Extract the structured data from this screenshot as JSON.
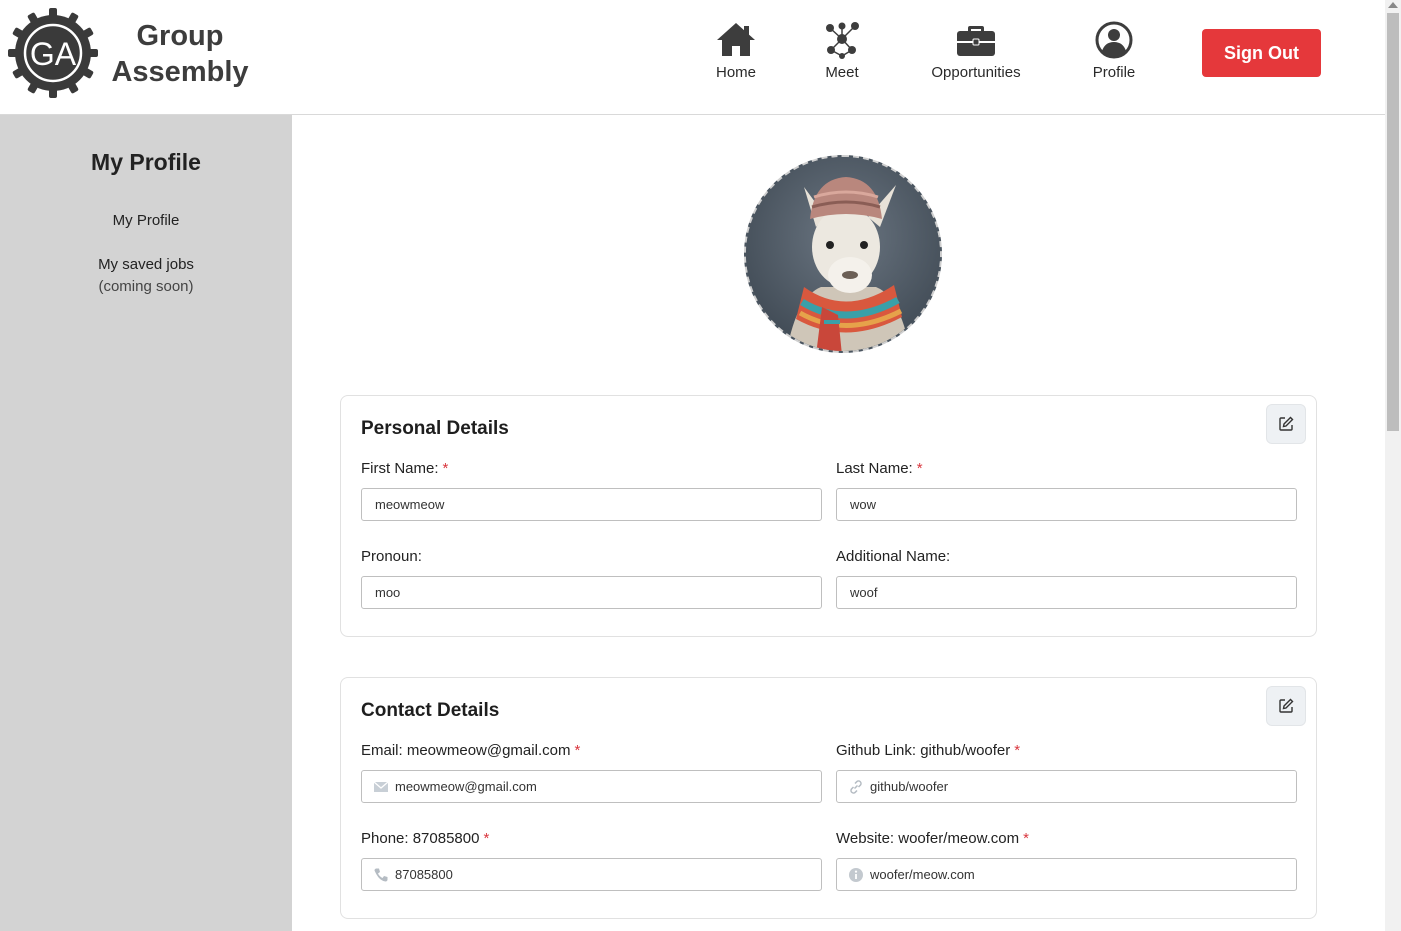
{
  "brand": {
    "name": "Group Assembly",
    "logo_text": "GA"
  },
  "nav": [
    {
      "label": "Home",
      "icon": "home-icon"
    },
    {
      "label": "Meet",
      "icon": "network-icon"
    },
    {
      "label": "Opportunities",
      "icon": "briefcase-icon"
    },
    {
      "label": "Profile",
      "icon": "user-circle-icon"
    }
  ],
  "signout_label": "Sign Out",
  "sidebar": {
    "title": "My Profile",
    "items": [
      {
        "label": "My Profile"
      },
      {
        "label": "My saved jobs",
        "sub": "(coming soon)"
      }
    ]
  },
  "personal": {
    "title": "Personal Details",
    "first_name": {
      "label": "First Name:",
      "required": "*",
      "value": "meowmeow"
    },
    "last_name": {
      "label": "Last Name:",
      "required": "*",
      "value": "wow"
    },
    "pronoun": {
      "label": "Pronoun:",
      "value": "moo"
    },
    "additional_name": {
      "label": "Additional Name:",
      "value": "woof"
    }
  },
  "contact": {
    "title": "Contact Details",
    "email": {
      "label": "Email: meowmeow@gmail.com",
      "required": "*",
      "value": "meowmeow@gmail.com",
      "icon": "mail-icon"
    },
    "github": {
      "label": "Github Link: github/woofer",
      "required": "*",
      "value": "github/woofer",
      "icon": "link-icon"
    },
    "phone": {
      "label": "Phone: 87085800",
      "required": "*",
      "value": "87085800",
      "icon": "phone-icon"
    },
    "website": {
      "label": "Website: woofer/meow.com",
      "required": "*",
      "value": "woofer/meow.com",
      "icon": "info-icon"
    }
  },
  "colors": {
    "accent": "#e5383b",
    "sidebar": "#d3d3d3",
    "required": "#d9363e"
  }
}
